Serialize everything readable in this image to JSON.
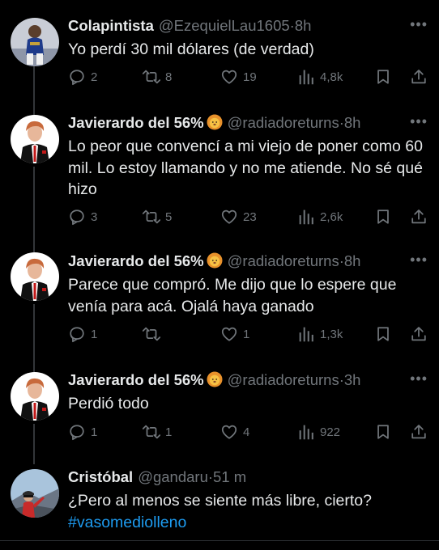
{
  "tweets": [
    {
      "name": "Colapintista",
      "has_emoji": false,
      "handle": "@EzequielLau1605",
      "sep": "·",
      "time": "8h",
      "text": "Yo perdí 30 mil dólares (de verdad)",
      "hashtag": "",
      "replies": "2",
      "retweets": "8",
      "likes": "19",
      "views": "4,8k"
    },
    {
      "name": "Javierardo del 56%",
      "has_emoji": true,
      "handle": "@radiadoreturns",
      "sep": "·",
      "time": "8h",
      "text": "Lo peor que convencí a mi viejo de poner como 60 mil. Lo estoy llamando y no me atiende. No sé qué hizo",
      "hashtag": "",
      "replies": "3",
      "retweets": "5",
      "likes": "23",
      "views": "2,6k"
    },
    {
      "name": "Javierardo del 56%",
      "has_emoji": true,
      "handle": "@radiadoreturns",
      "sep": "·",
      "time": "8h",
      "text": "Parece que compró. Me dijo que lo espere que venía para acá. Ojalá haya ganado",
      "hashtag": "",
      "replies": "1",
      "retweets": "",
      "likes": "1",
      "views": "1,3k"
    },
    {
      "name": "Javierardo del 56%",
      "has_emoji": true,
      "handle": "@radiadoreturns",
      "sep": "·",
      "time": "3h",
      "text": "Perdió todo",
      "hashtag": "",
      "replies": "1",
      "retweets": "1",
      "likes": "4",
      "views": "922"
    },
    {
      "name": "Cristóbal",
      "has_emoji": false,
      "handle": "@gandaru",
      "sep": "·",
      "time": "51 m",
      "text": "¿Pero al menos se siente más libre, cierto?",
      "hashtag": "#vasomediolleno",
      "replies": "",
      "retweets": "",
      "likes": "",
      "views": ""
    }
  ],
  "icons": {
    "reply": "reply-icon",
    "retweet": "retweet-icon",
    "like": "heart-icon",
    "views": "views-chart-icon",
    "bookmark": "bookmark-icon",
    "share": "share-icon",
    "more": "more-icon",
    "emoji": "lion-emoji-icon"
  },
  "colors": {
    "background": "#000000",
    "text": "#e7e9ea",
    "muted": "#71767b",
    "link": "#1d9bf0",
    "thread_line": "#333639"
  }
}
